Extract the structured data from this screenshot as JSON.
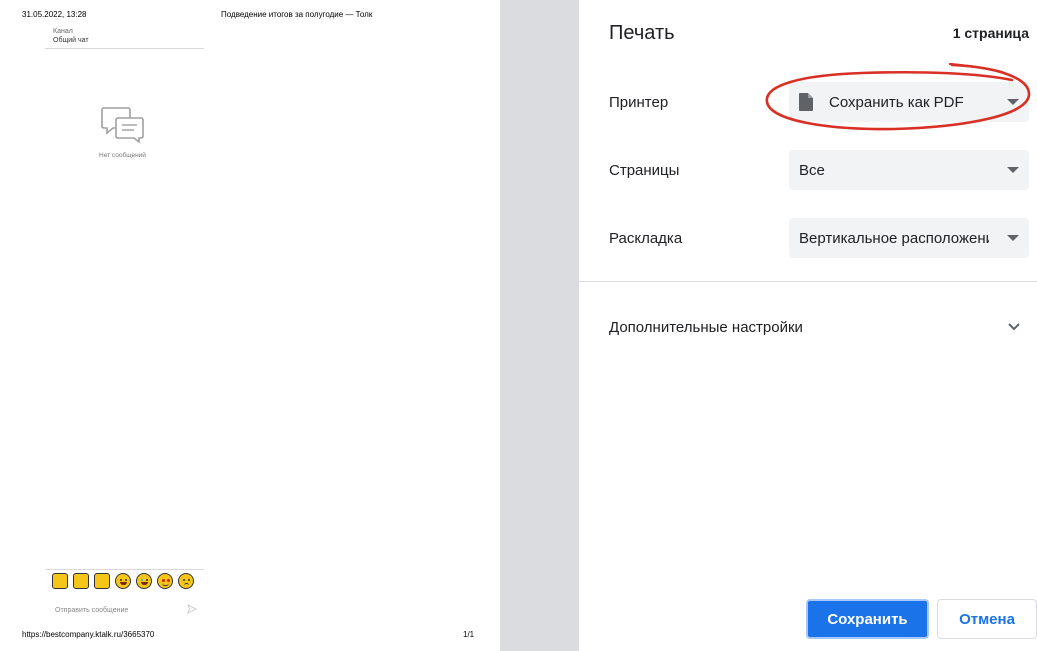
{
  "preview": {
    "header_date": "31.05.2022, 13:28",
    "header_title": "Подведение итогов за полугодие — Толк",
    "channel_label": "Канал",
    "channel_name": "Общий чат",
    "empty_text": "Нет сообщений",
    "emojis": [
      "thumbs-up",
      "thumbs-down",
      "clapping-hands",
      "laughing",
      "crying",
      "heart-eyes",
      "sad-face"
    ],
    "send_placeholder": "Отправить сообщение",
    "footer_url": "https://bestcompany.ktalk.ru/3665370",
    "footer_page": "1/1"
  },
  "dialog": {
    "title": "Печать",
    "page_count": "1 страница",
    "printer": {
      "label": "Принтер",
      "value": "Сохранить как PDF",
      "icon": "document-icon"
    },
    "pages": {
      "label": "Страницы",
      "value": "Все"
    },
    "layout": {
      "label": "Раскладка",
      "value": "Вертикальное расположение"
    },
    "more_settings": "Дополнительные настройки",
    "save_label": "Сохранить",
    "cancel_label": "Отмена"
  },
  "colors": {
    "accent": "#1a73e8",
    "annotation": "#d93025",
    "select_bg": "#f1f3f4",
    "gutter": "#dadce0"
  }
}
